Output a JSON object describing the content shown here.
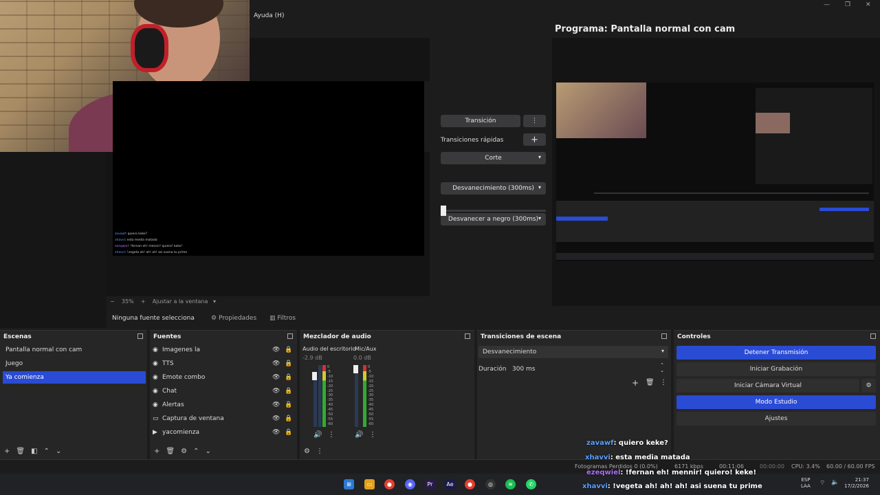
{
  "menu": {
    "help": "Ayuda (H)"
  },
  "preview": {
    "chat": [
      {
        "user": "zavawf",
        "text": ": quiero keke?"
      },
      {
        "user": "xhavvi",
        "text": ": esta media matada"
      },
      {
        "user": "ezeqwiel",
        "text": ": !fernan eh! mennir! quiero! keke!"
      },
      {
        "user": "xhavvi",
        "text": ": !vegeta ah! ah! ah! asi suena tu prime"
      }
    ],
    "zoom": "35%",
    "fit_label": "Ajustar a la ventana"
  },
  "transitions_panel": {
    "transition_button": "Transición",
    "quick_label": "Transiciones rápidas",
    "items": [
      "Corte",
      "Desvanecimiento (300ms)",
      "Desvanecer a negro (300ms)"
    ]
  },
  "program": {
    "title": "Programa: Pantalla normal con cam"
  },
  "source_toolbar": {
    "no_source": "Ninguna fuente selecciona",
    "properties": "Propiedades",
    "filters": "Filtros"
  },
  "scenes": {
    "title": "Escenas",
    "items": [
      "Pantalla normal con cam",
      "Juego",
      "Ya comienza"
    ],
    "selected": "Ya comienza"
  },
  "sources": {
    "title": "Fuentes",
    "items": [
      "Imagenes la",
      "TTS",
      "Emote combo",
      "Chat",
      "Alertas",
      "Captura de ventana",
      "yacomienza"
    ]
  },
  "mixer": {
    "title": "Mezclador de audio",
    "channels": [
      {
        "name": "Audio del escritorio",
        "db": "-2.9 dB",
        "level": 0.55
      },
      {
        "name": "Mic/Aux",
        "db": "0.0 dB",
        "level": 0.6
      }
    ],
    "scale": [
      "0",
      "-5",
      "-10",
      "-15",
      "-20",
      "-25",
      "-30",
      "-35",
      "-40",
      "-45",
      "-50",
      "-55",
      "-60"
    ]
  },
  "scene_transitions": {
    "title": "Transiciones de escena",
    "selected": "Desvanecimiento",
    "duration_label": "Duración",
    "duration_value": "300 ms"
  },
  "controls": {
    "title": "Controles",
    "stop_stream": "Detener Transmisión",
    "start_recording": "Iniciar Grabación",
    "start_virtualcam": "Iniciar Cámara Virtual",
    "studio_mode": "Modo Estudio",
    "settings": "Ajustes"
  },
  "status": {
    "dropped": "Fotogramas Perdidos 0 (0.0%)",
    "bitrate": "6171 kbps",
    "stream_time": "00:11:06",
    "rec_time": "00:00:00",
    "cpu": "CPU: 3.4%",
    "fps": "60.00 / 60.00 FPS"
  },
  "overlay_chat": [
    {
      "user": "zavawf",
      "text": ": quiero keke?",
      "color": "#5aa0ff"
    },
    {
      "user": "xhavvi",
      "text": ": esta media matada",
      "color": "#5aa0ff"
    },
    {
      "user": "ezeqwiel",
      "text": ": !fernan eh! mennir! quiero! keke!",
      "color": "#b070ff"
    },
    {
      "user": "xhavvi",
      "text": ": !vegeta ah! ah! ah! asi suena tu prime",
      "color": "#5aa0ff"
    }
  ],
  "taskbar": {
    "lang": "ESP",
    "lang2": "LAA",
    "time": "21:37",
    "date": "17/2/2026"
  }
}
